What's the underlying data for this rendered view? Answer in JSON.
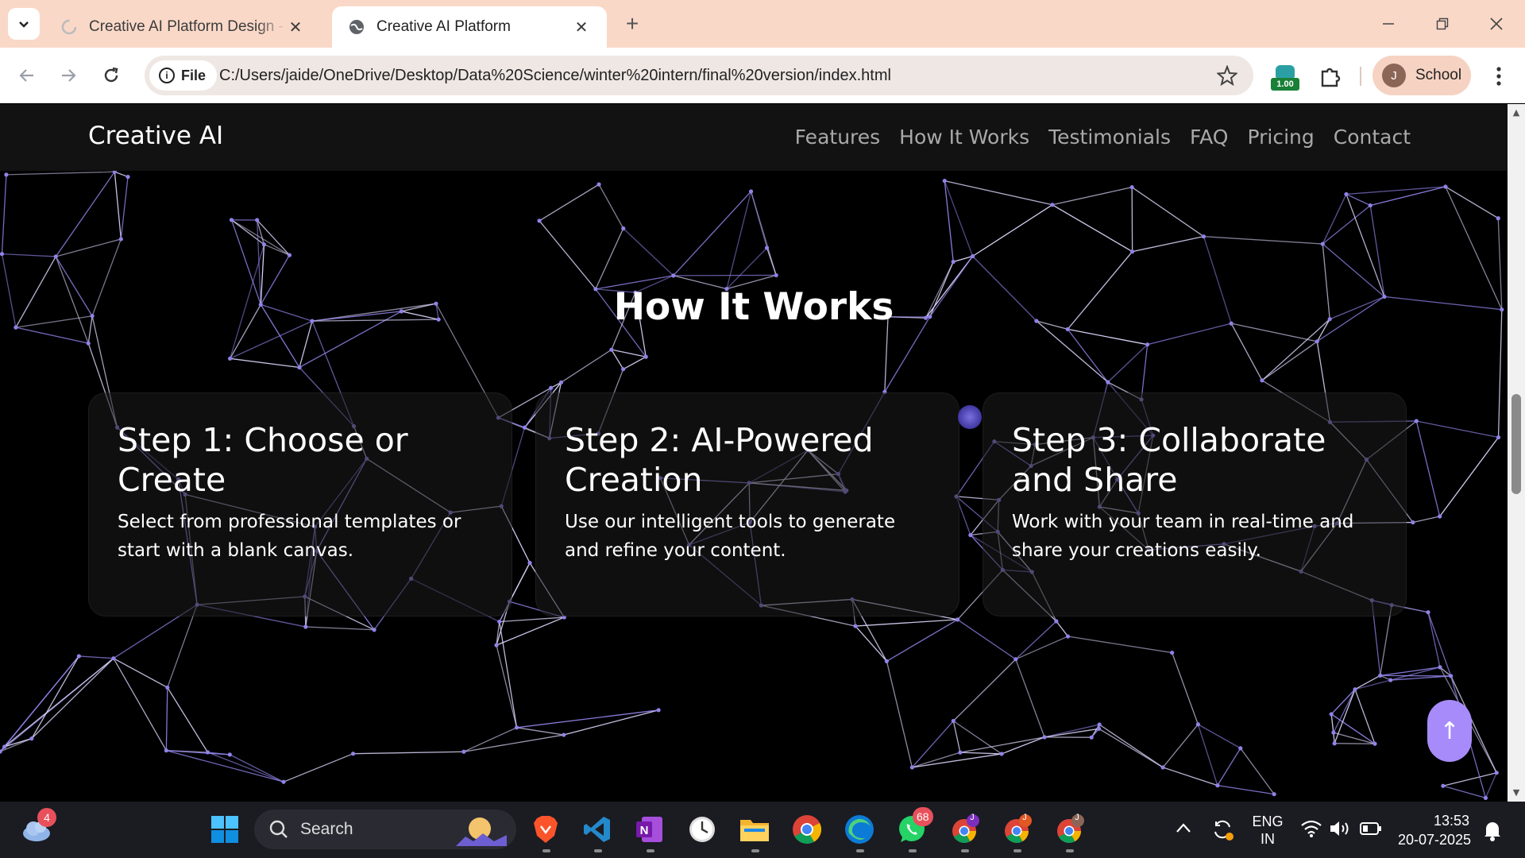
{
  "browser": {
    "tabs": [
      {
        "title": "Creative AI Platform Design - G",
        "active": false
      },
      {
        "title": "Creative AI Platform",
        "active": true
      }
    ],
    "site_chip": "File",
    "url": "C:/Users/jaide/OneDrive/Desktop/Data%20Science/winter%20intern/final%20version/index.html",
    "extension_badge": "1.00",
    "profile_initial": "J",
    "profile_name": "School"
  },
  "site": {
    "brand": "Creative AI",
    "nav": [
      "Features",
      "How It Works",
      "Testimonials",
      "FAQ",
      "Pricing",
      "Contact"
    ],
    "section_title": "How It Works",
    "steps": [
      {
        "title": "Step 1: Choose or Create",
        "text": "Select from professional templates or start with a blank canvas."
      },
      {
        "title": "Step 2: AI-Powered Creation",
        "text": "Use our intelligent tools to generate and refine your content."
      },
      {
        "title": "Step 3: Collaborate and Share",
        "text": "Work with your team in real-time and share your creations easily."
      }
    ],
    "scroll_top_symbol": "↑",
    "accent": "#a78bfa",
    "network_color": "#8f83e8"
  },
  "taskbar": {
    "weather_badge": "4",
    "search_label": "Search",
    "whatsapp_badge": "68",
    "chrome_profiles": [
      "J",
      "J",
      "J"
    ],
    "language_line1": "ENG",
    "language_line2": "IN",
    "time": "13:53",
    "date": "20-07-2025"
  }
}
